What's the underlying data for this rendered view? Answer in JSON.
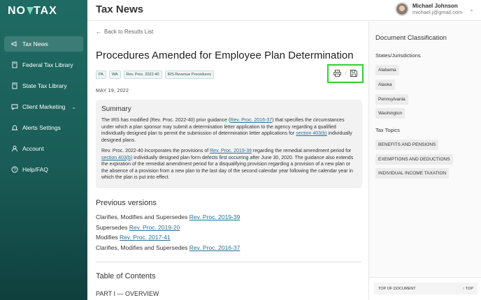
{
  "brand": {
    "logo_pre": "NO",
    "logo_post": "TAX"
  },
  "sidebar": {
    "items": [
      {
        "label": "Tax News",
        "icon": "megaphone-icon"
      },
      {
        "label": "Federal Tax Library",
        "icon": "book-icon"
      },
      {
        "label": "State Tax Library",
        "icon": "book-icon"
      },
      {
        "label": "Client Marketing",
        "icon": "chat-icon"
      },
      {
        "label": "Alerts Settings",
        "icon": "bell-icon"
      },
      {
        "label": "Account",
        "icon": "user-icon"
      },
      {
        "label": "Help/FAQ",
        "icon": "help-icon"
      }
    ]
  },
  "header": {
    "title": "Tax News",
    "user_name": "Michael Johnson",
    "user_email": "michael.j@gmail.com"
  },
  "main": {
    "back_label": "Back to Results List",
    "doc_title": "Procedures Amended for Employee Plan Determination",
    "tags": [
      "PA",
      "WA",
      "Rev. Proc. 2022-40",
      "IRS Revenue Procedures"
    ],
    "date": "MAY 19, 2022",
    "summary": {
      "heading": "Summary",
      "p1_a": "The IRS has modified (Rev. Proc. 2022-40) prior guidance (",
      "p1_link1": "Rev. Proc. 2016-37",
      "p1_b": ") that specifies the circumstances under which a plan sponsor may submit a determination letter application to the agency regarding a qualified individually designed plan to permit the submission of determination letter applications for ",
      "p1_link2": "section 403(b)",
      "p1_c": " individually designed plans.",
      "p2_a": "Rev. Proc. 2022-40 incorporates the provisions of ",
      "p2_link1": "Rev. Proc. 2019-39",
      "p2_b": " regarding the remedial amendment period for ",
      "p2_link2": "section 403(b)",
      "p2_c": " individually designed plan form defects first occurring after June 30, 2020. The guidance also extends the expiration of the remedial amendment period for a disqualifying provision regarding a provision of a new plan or the absence of a provision from a new plan to the last day of the second calendar year following the calendar year in which the plan is put into effect."
    },
    "previous_title": "Previous versions",
    "previous": [
      {
        "text": "Clarifies, Modifies and Supersedes ",
        "link": "Rev. Proc. 2019-39"
      },
      {
        "text": "Supersedes ",
        "link": "Rev. Proc. 2019-20"
      },
      {
        "text": "Modifies ",
        "link": "Rev. Proc. 2017-41"
      },
      {
        "text": "Clarifies, Modifies and Supersedes ",
        "link": "Rev. Proc. 2016-37"
      }
    ],
    "toc_title": "Table of Contents",
    "part1": "PART I — OVERVIEW"
  },
  "right_panel": {
    "title": "Document Classification",
    "states_title": "States/Jurisdictions",
    "states": [
      "Alabama",
      "Alaska",
      "Pennsylvania",
      "Washington"
    ],
    "topics_title": "Tax Topics",
    "topics": [
      "BENEFITS AND PENSIONS",
      "EXEMPTIONS AND DEDUCTIONS",
      "INDIVIDUAL INCOME TAXATION"
    ],
    "top_of_document": "TOP OF DOCUMENT",
    "top_button": "TOP"
  },
  "colors": {
    "sidebar": "#1f6b63",
    "highlight_border": "#2ed12e",
    "link": "#2a6f93"
  }
}
